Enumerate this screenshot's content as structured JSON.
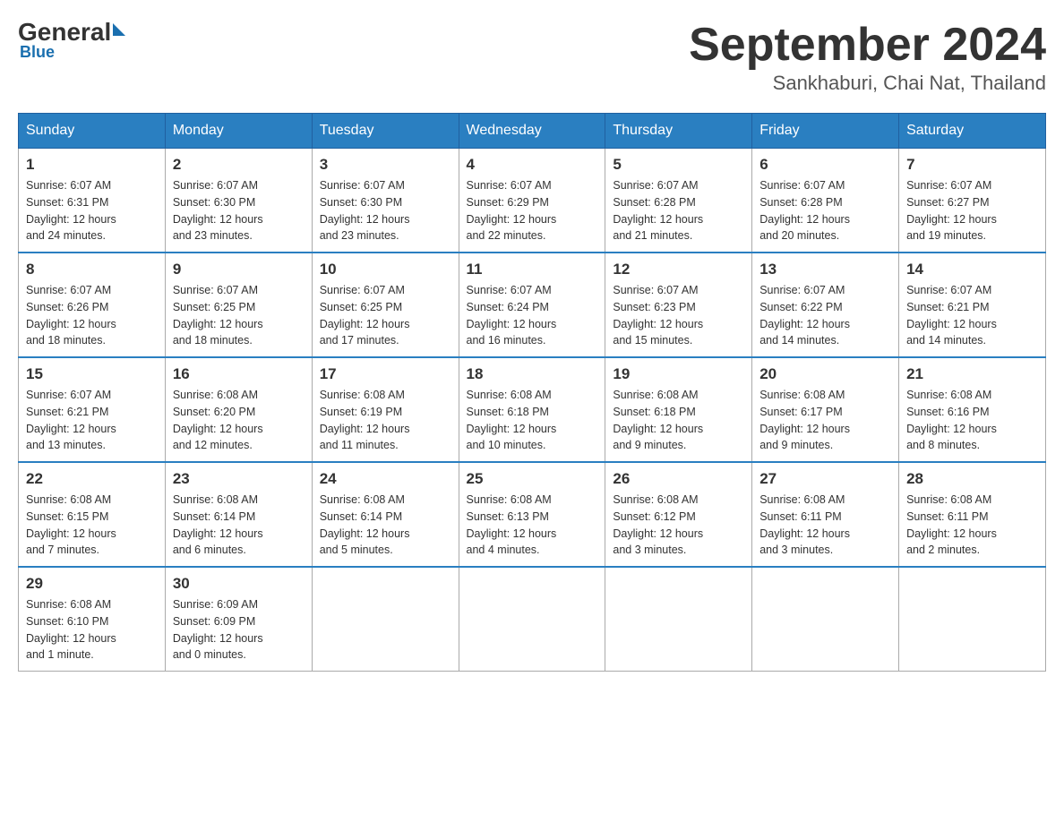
{
  "header": {
    "logo_general": "General",
    "logo_blue": "Blue",
    "month_title": "September 2024",
    "location": "Sankhaburi, Chai Nat, Thailand"
  },
  "weekdays": [
    "Sunday",
    "Monday",
    "Tuesday",
    "Wednesday",
    "Thursday",
    "Friday",
    "Saturday"
  ],
  "weeks": [
    [
      {
        "day": "1",
        "sunrise": "6:07 AM",
        "sunset": "6:31 PM",
        "daylight": "12 hours and 24 minutes."
      },
      {
        "day": "2",
        "sunrise": "6:07 AM",
        "sunset": "6:30 PM",
        "daylight": "12 hours and 23 minutes."
      },
      {
        "day": "3",
        "sunrise": "6:07 AM",
        "sunset": "6:30 PM",
        "daylight": "12 hours and 23 minutes."
      },
      {
        "day": "4",
        "sunrise": "6:07 AM",
        "sunset": "6:29 PM",
        "daylight": "12 hours and 22 minutes."
      },
      {
        "day": "5",
        "sunrise": "6:07 AM",
        "sunset": "6:28 PM",
        "daylight": "12 hours and 21 minutes."
      },
      {
        "day": "6",
        "sunrise": "6:07 AM",
        "sunset": "6:28 PM",
        "daylight": "12 hours and 20 minutes."
      },
      {
        "day": "7",
        "sunrise": "6:07 AM",
        "sunset": "6:27 PM",
        "daylight": "12 hours and 19 minutes."
      }
    ],
    [
      {
        "day": "8",
        "sunrise": "6:07 AM",
        "sunset": "6:26 PM",
        "daylight": "12 hours and 18 minutes."
      },
      {
        "day": "9",
        "sunrise": "6:07 AM",
        "sunset": "6:25 PM",
        "daylight": "12 hours and 18 minutes."
      },
      {
        "day": "10",
        "sunrise": "6:07 AM",
        "sunset": "6:25 PM",
        "daylight": "12 hours and 17 minutes."
      },
      {
        "day": "11",
        "sunrise": "6:07 AM",
        "sunset": "6:24 PM",
        "daylight": "12 hours and 16 minutes."
      },
      {
        "day": "12",
        "sunrise": "6:07 AM",
        "sunset": "6:23 PM",
        "daylight": "12 hours and 15 minutes."
      },
      {
        "day": "13",
        "sunrise": "6:07 AM",
        "sunset": "6:22 PM",
        "daylight": "12 hours and 14 minutes."
      },
      {
        "day": "14",
        "sunrise": "6:07 AM",
        "sunset": "6:21 PM",
        "daylight": "12 hours and 14 minutes."
      }
    ],
    [
      {
        "day": "15",
        "sunrise": "6:07 AM",
        "sunset": "6:21 PM",
        "daylight": "12 hours and 13 minutes."
      },
      {
        "day": "16",
        "sunrise": "6:08 AM",
        "sunset": "6:20 PM",
        "daylight": "12 hours and 12 minutes."
      },
      {
        "day": "17",
        "sunrise": "6:08 AM",
        "sunset": "6:19 PM",
        "daylight": "12 hours and 11 minutes."
      },
      {
        "day": "18",
        "sunrise": "6:08 AM",
        "sunset": "6:18 PM",
        "daylight": "12 hours and 10 minutes."
      },
      {
        "day": "19",
        "sunrise": "6:08 AM",
        "sunset": "6:18 PM",
        "daylight": "12 hours and 9 minutes."
      },
      {
        "day": "20",
        "sunrise": "6:08 AM",
        "sunset": "6:17 PM",
        "daylight": "12 hours and 9 minutes."
      },
      {
        "day": "21",
        "sunrise": "6:08 AM",
        "sunset": "6:16 PM",
        "daylight": "12 hours and 8 minutes."
      }
    ],
    [
      {
        "day": "22",
        "sunrise": "6:08 AM",
        "sunset": "6:15 PM",
        "daylight": "12 hours and 7 minutes."
      },
      {
        "day": "23",
        "sunrise": "6:08 AM",
        "sunset": "6:14 PM",
        "daylight": "12 hours and 6 minutes."
      },
      {
        "day": "24",
        "sunrise": "6:08 AM",
        "sunset": "6:14 PM",
        "daylight": "12 hours and 5 minutes."
      },
      {
        "day": "25",
        "sunrise": "6:08 AM",
        "sunset": "6:13 PM",
        "daylight": "12 hours and 4 minutes."
      },
      {
        "day": "26",
        "sunrise": "6:08 AM",
        "sunset": "6:12 PM",
        "daylight": "12 hours and 3 minutes."
      },
      {
        "day": "27",
        "sunrise": "6:08 AM",
        "sunset": "6:11 PM",
        "daylight": "12 hours and 3 minutes."
      },
      {
        "day": "28",
        "sunrise": "6:08 AM",
        "sunset": "6:11 PM",
        "daylight": "12 hours and 2 minutes."
      }
    ],
    [
      {
        "day": "29",
        "sunrise": "6:08 AM",
        "sunset": "6:10 PM",
        "daylight": "12 hours and 1 minute."
      },
      {
        "day": "30",
        "sunrise": "6:09 AM",
        "sunset": "6:09 PM",
        "daylight": "12 hours and 0 minutes."
      },
      null,
      null,
      null,
      null,
      null
    ]
  ],
  "labels": {
    "sunrise": "Sunrise:",
    "sunset": "Sunset:",
    "daylight": "Daylight:"
  }
}
